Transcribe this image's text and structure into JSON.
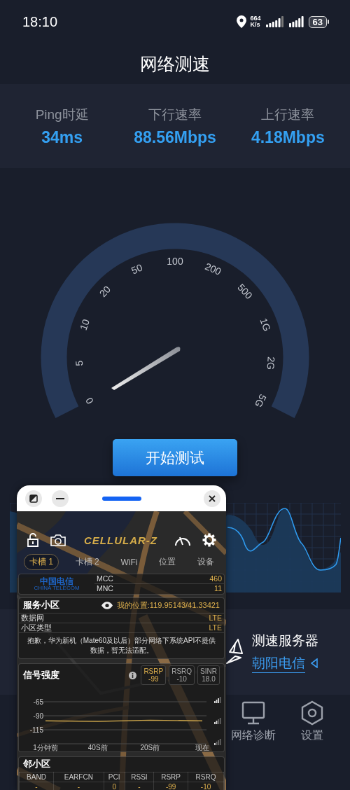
{
  "status_bar": {
    "time": "18:10",
    "net_speed": "664",
    "net_unit": "K/s",
    "battery": "63"
  },
  "title": "网络测速",
  "stats": [
    {
      "label": "Ping时延",
      "value": "34ms"
    },
    {
      "label": "下行速率",
      "value": "88.56Mbps"
    },
    {
      "label": "上行速率",
      "value": "4.18Mbps"
    }
  ],
  "gauge": {
    "ticks": [
      "0",
      "5",
      "10",
      "20",
      "50",
      "100",
      "200",
      "500",
      "1G",
      "2G",
      "5G"
    ]
  },
  "start_button": "开始测试",
  "server": {
    "label": "测速服务器",
    "name": "朝阳电信"
  },
  "nav": [
    {
      "label": "网络诊断",
      "selected": false
    },
    {
      "label": "设置",
      "selected": false
    }
  ],
  "overlay": {
    "logo": "CELLULAR-Z",
    "tabs": [
      {
        "label": "卡槽 1",
        "selected": true
      },
      {
        "label": "卡槽 2",
        "selected": false
      },
      {
        "label": "WiFi",
        "selected": false
      },
      {
        "label": "位置",
        "selected": false
      },
      {
        "label": "设备",
        "selected": false
      }
    ],
    "operator": {
      "logo_cn": "中国电信",
      "logo_en": "CHINA TELECOM",
      "rows": [
        {
          "label": "MCC",
          "value": "460"
        },
        {
          "label": "MNC",
          "value": "11"
        }
      ]
    },
    "serving_cell": {
      "title": "服务小区",
      "location": "我的位置:119.95143/41.33421",
      "rows": [
        {
          "label": "数据网",
          "value": "LTE"
        },
        {
          "label": "小区类型",
          "value": "LTE"
        }
      ],
      "notice": "抱歉，华为新机（Mate60及以后）部分网络下系统API不提供数据，暂无法适配。"
    },
    "signal": {
      "title": "信号强度",
      "metrics": [
        {
          "label": "RSRP",
          "value": "-99",
          "selected": true
        },
        {
          "label": "RSRQ",
          "value": "-10",
          "selected": false
        },
        {
          "label": "SINR",
          "value": "18.0",
          "selected": false
        }
      ],
      "chart_data": {
        "type": "line",
        "categories": [
          "1分钟前",
          "40S前",
          "20S前",
          "现在"
        ],
        "series": [
          {
            "color": "#c8a24a",
            "values": [
              -99,
              -100,
              -98,
              -99
            ]
          }
        ],
        "ylim": [
          -140,
          -65
        ],
        "yticks": [
          -65,
          -90,
          -115
        ],
        "grid": true
      }
    },
    "neighbors": {
      "title": "邻小区",
      "columns": [
        "BAND",
        "EARFCN",
        "PCI",
        "RSSI",
        "RSRP",
        "RSRQ"
      ],
      "rows": [
        [
          "-",
          "-",
          "0",
          "-",
          "-99",
          "-10"
        ]
      ]
    }
  }
}
